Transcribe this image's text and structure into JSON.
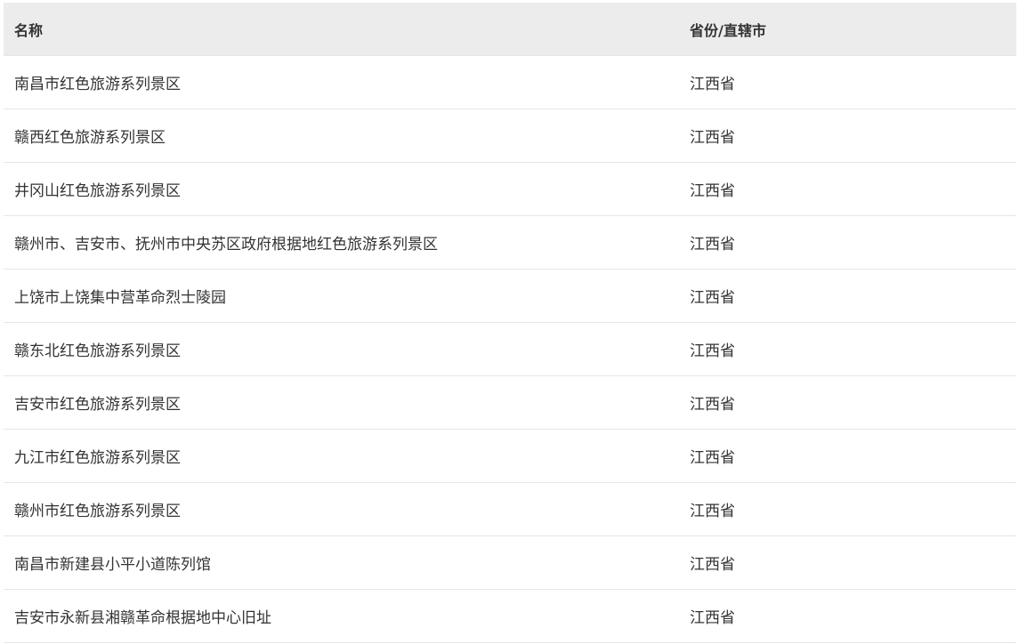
{
  "table": {
    "headers": {
      "name": "名称",
      "province": "省份/直辖市"
    },
    "rows": [
      {
        "name": "南昌市红色旅游系列景区",
        "province": "江西省"
      },
      {
        "name": "赣西红色旅游系列景区",
        "province": "江西省"
      },
      {
        "name": "井冈山红色旅游系列景区",
        "province": "江西省"
      },
      {
        "name": "赣州市、吉安市、抚州市中央苏区政府根据地红色旅游系列景区",
        "province": "江西省"
      },
      {
        "name": "上饶市上饶集中营革命烈士陵园",
        "province": "江西省"
      },
      {
        "name": "赣东北红色旅游系列景区",
        "province": "江西省"
      },
      {
        "name": "吉安市红色旅游系列景区",
        "province": "江西省"
      },
      {
        "name": "九江市红色旅游系列景区",
        "province": "江西省"
      },
      {
        "name": "赣州市红色旅游系列景区",
        "province": "江西省"
      },
      {
        "name": "南昌市新建县小平小道陈列馆",
        "province": "江西省"
      },
      {
        "name": "吉安市永新县湘赣革命根据地中心旧址",
        "province": "江西省"
      }
    ]
  }
}
